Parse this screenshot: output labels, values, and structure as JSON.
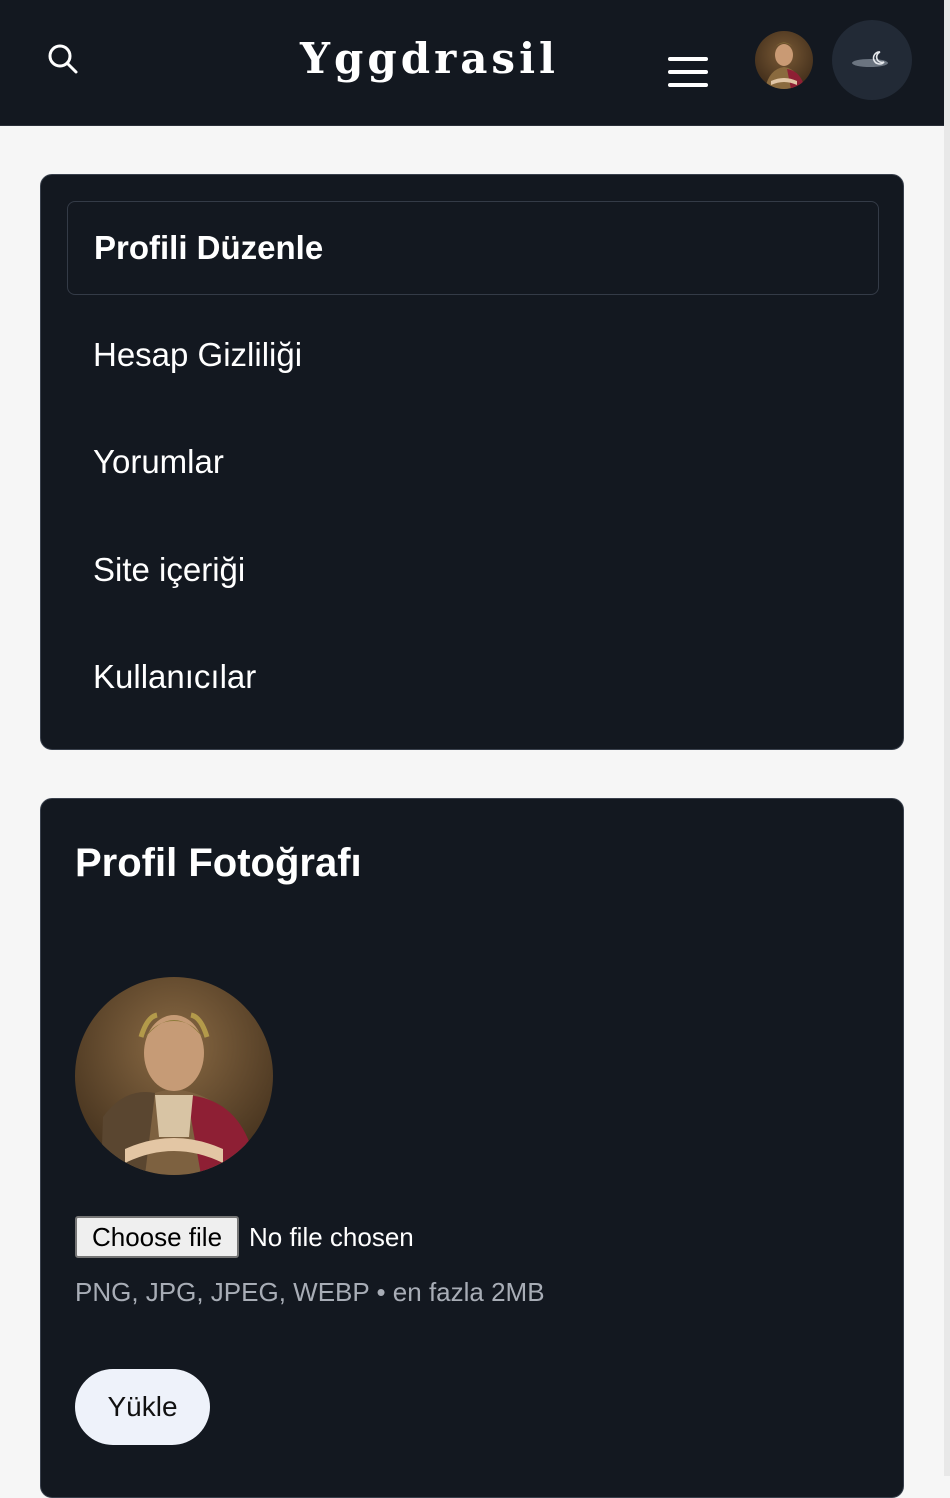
{
  "header": {
    "brand": "Yggdrasil",
    "search_icon": "search-icon",
    "menu_icon": "hamburger-menu-icon",
    "theme_icon": "moon-icon",
    "background": "#131820"
  },
  "nav": {
    "items": [
      {
        "label": "Profili Düzenle",
        "active": true
      },
      {
        "label": "Hesap Gizliliği",
        "active": false
      },
      {
        "label": "Yorumlar",
        "active": false
      },
      {
        "label": "Site içeriği",
        "active": false
      },
      {
        "label": "Kullanıcılar",
        "active": false
      }
    ]
  },
  "photo": {
    "title": "Profil Fotoğrafı",
    "choose_label": "Choose file",
    "no_file_label": "No file chosen",
    "hint": "PNG, JPG, JPEG, WEBP • en fazla 2MB",
    "upload_label": "Yükle"
  },
  "colors": {
    "card_bg": "#131820",
    "page_bg": "#f6f6f6",
    "upload_bg": "#eef2fa",
    "hint_text": "#a8adb6"
  }
}
